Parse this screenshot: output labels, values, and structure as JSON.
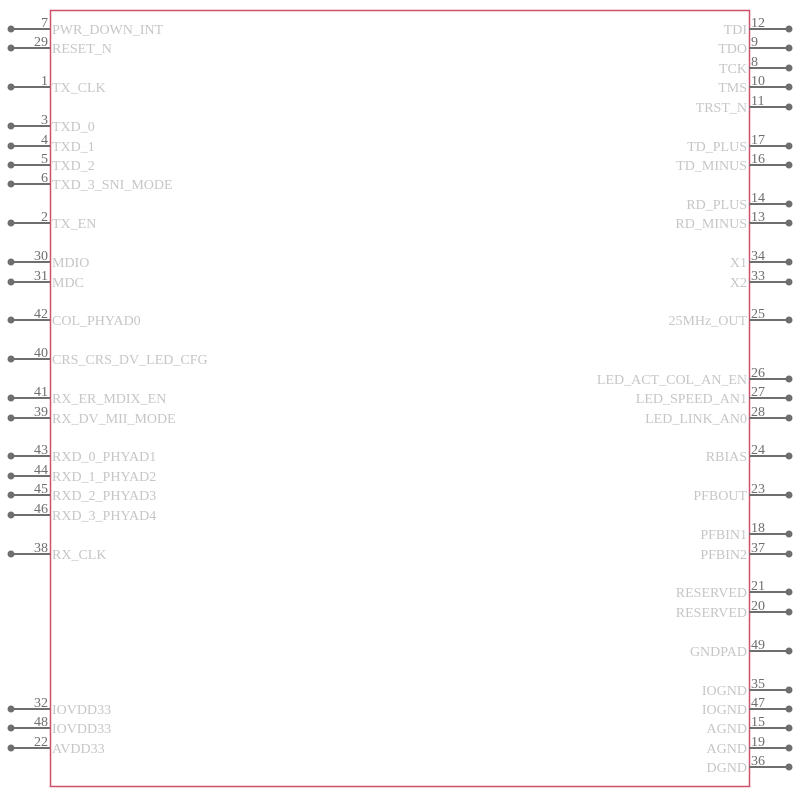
{
  "component": {
    "body_color": "#d0506a",
    "pin_color": "#6e6e6e",
    "name_color": "#c6c6c6",
    "left_pins": [
      {
        "number": "7",
        "name": "PWR_DOWN_INT",
        "slot": 0
      },
      {
        "number": "29",
        "name": "RESET_N",
        "slot": 1
      },
      {
        "number": "1",
        "name": "TX_CLK",
        "slot": 3
      },
      {
        "number": "3",
        "name": "TXD_0",
        "slot": 5
      },
      {
        "number": "4",
        "name": "TXD_1",
        "slot": 6
      },
      {
        "number": "5",
        "name": "TXD_2",
        "slot": 7
      },
      {
        "number": "6",
        "name": "TXD_3_SNI_MODE",
        "slot": 8
      },
      {
        "number": "2",
        "name": "TX_EN",
        "slot": 10
      },
      {
        "number": "30",
        "name": "MDIO",
        "slot": 12
      },
      {
        "number": "31",
        "name": "MDC",
        "slot": 13
      },
      {
        "number": "42",
        "name": "COL_PHYAD0",
        "slot": 15
      },
      {
        "number": "40",
        "name": "CRS_CRS_DV_LED_CFG",
        "slot": 17
      },
      {
        "number": "41",
        "name": "RX_ER_MDIX_EN",
        "slot": 19
      },
      {
        "number": "39",
        "name": "RX_DV_MII_MODE",
        "slot": 20
      },
      {
        "number": "43",
        "name": "RXD_0_PHYAD1",
        "slot": 22
      },
      {
        "number": "44",
        "name": "RXD_1_PHYAD2",
        "slot": 23
      },
      {
        "number": "45",
        "name": "RXD_2_PHYAD3",
        "slot": 24
      },
      {
        "number": "46",
        "name": "RXD_3_PHYAD4",
        "slot": 25
      },
      {
        "number": "38",
        "name": "RX_CLK",
        "slot": 27
      },
      {
        "number": "32",
        "name": "IOVDD33",
        "slot": 35
      },
      {
        "number": "48",
        "name": "IOVDD33",
        "slot": 36
      },
      {
        "number": "22",
        "name": "AVDD33",
        "slot": 37
      }
    ],
    "right_pins": [
      {
        "number": "12",
        "name": "TDI",
        "slot": 0
      },
      {
        "number": "9",
        "name": "TDO",
        "slot": 1
      },
      {
        "number": "8",
        "name": "TCK",
        "slot": 2
      },
      {
        "number": "10",
        "name": "TMS",
        "slot": 3
      },
      {
        "number": "11",
        "name": "TRST_N",
        "slot": 4
      },
      {
        "number": "17",
        "name": "TD_PLUS",
        "slot": 6
      },
      {
        "number": "16",
        "name": "TD_MINUS",
        "slot": 7
      },
      {
        "number": "14",
        "name": "RD_PLUS",
        "slot": 9
      },
      {
        "number": "13",
        "name": "RD_MINUS",
        "slot": 10
      },
      {
        "number": "34",
        "name": "X1",
        "slot": 12
      },
      {
        "number": "33",
        "name": "X2",
        "slot": 13
      },
      {
        "number": "25",
        "name": "25MHz_OUT",
        "slot": 15
      },
      {
        "number": "26",
        "name": "LED_ACT_COL_AN_EN",
        "slot": 18
      },
      {
        "number": "27",
        "name": "LED_SPEED_AN1",
        "slot": 19
      },
      {
        "number": "28",
        "name": "LED_LINK_AN0",
        "slot": 20
      },
      {
        "number": "24",
        "name": "RBIAS",
        "slot": 22
      },
      {
        "number": "23",
        "name": "PFBOUT",
        "slot": 24
      },
      {
        "number": "18",
        "name": "PFBIN1",
        "slot": 26
      },
      {
        "number": "37",
        "name": "PFBIN2",
        "slot": 27
      },
      {
        "number": "21",
        "name": "RESERVED",
        "slot": 29
      },
      {
        "number": "20",
        "name": "RESERVED",
        "slot": 30
      },
      {
        "number": "49",
        "name": "GNDPAD",
        "slot": 32
      },
      {
        "number": "35",
        "name": "IOGND",
        "slot": 34
      },
      {
        "number": "47",
        "name": "IOGND",
        "slot": 35
      },
      {
        "number": "15",
        "name": "AGND",
        "slot": 36
      },
      {
        "number": "19",
        "name": "AGND",
        "slot": 37
      },
      {
        "number": "36",
        "name": "DGND",
        "slot": 38
      }
    ]
  }
}
